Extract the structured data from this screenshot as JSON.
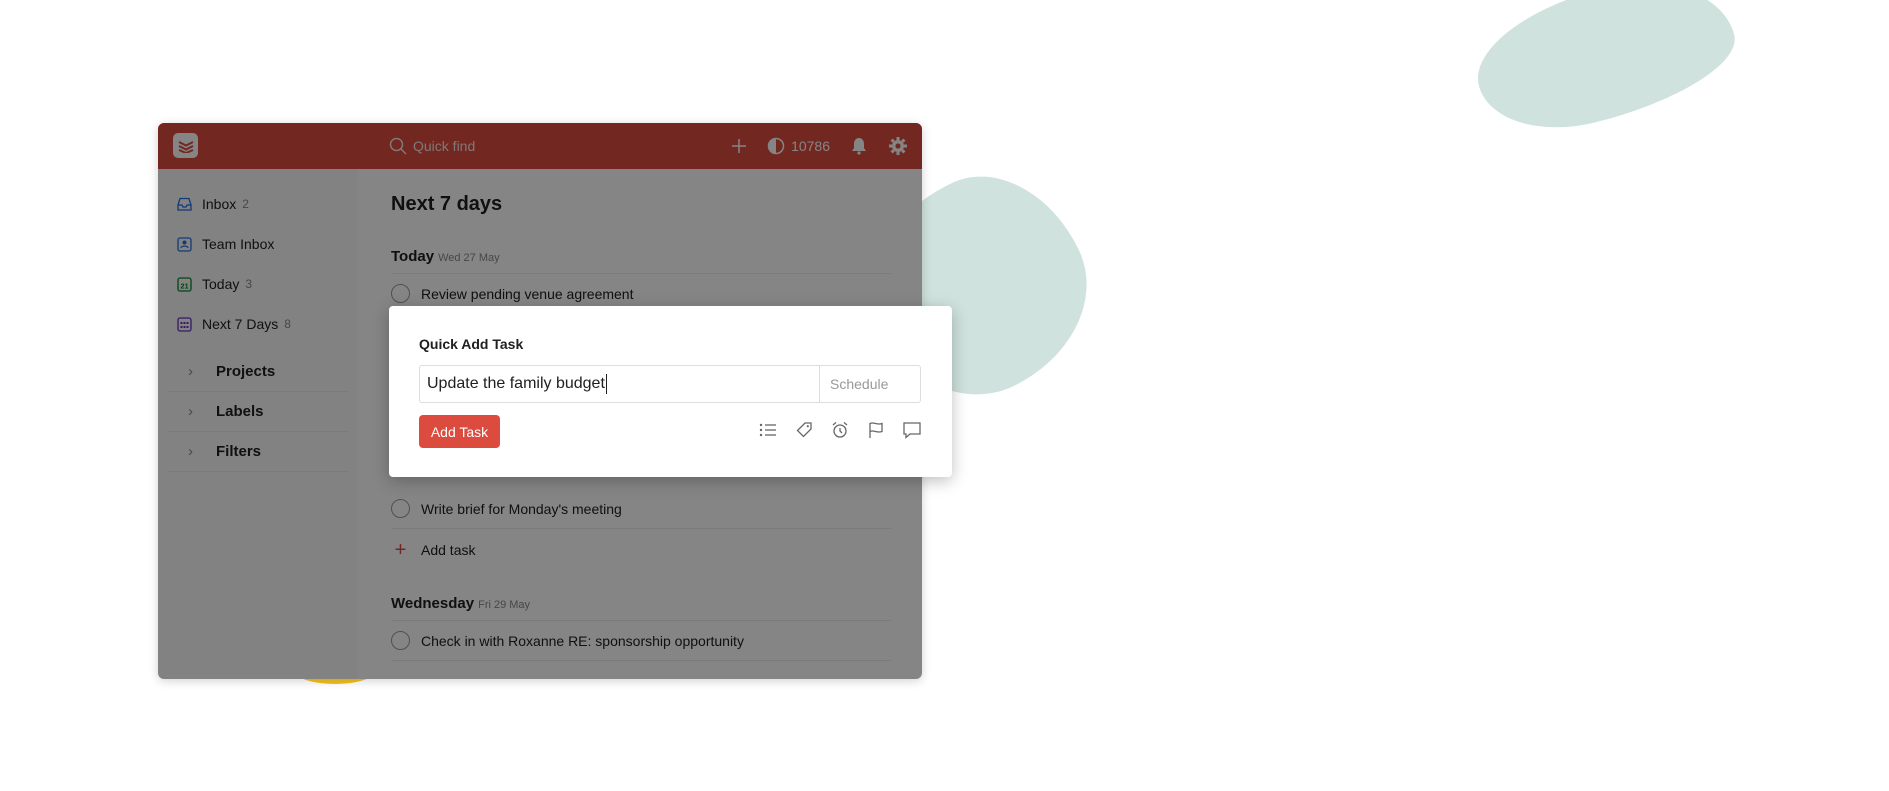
{
  "topbar": {
    "search_placeholder": "Quick find",
    "karma": "10786"
  },
  "sidebar": {
    "items": [
      {
        "label": "Inbox",
        "count": "2",
        "icon": "inbox-icon",
        "color": "#246fe0"
      },
      {
        "label": "Team Inbox",
        "count": "",
        "icon": "team-inbox-icon",
        "color": "#246fe0"
      },
      {
        "label": "Today",
        "count": "3",
        "icon": "calendar-today-icon",
        "color": "#058527"
      },
      {
        "label": "Next 7 Days",
        "count": "8",
        "icon": "calendar-week-icon",
        "color": "#692fc2"
      }
    ],
    "groups": [
      {
        "label": "Projects"
      },
      {
        "label": "Labels"
      },
      {
        "label": "Filters"
      }
    ]
  },
  "main": {
    "title": "Next 7 days",
    "sections": [
      {
        "day": "Today",
        "date": "Wed 27 May"
      },
      {
        "day": "Wednesday",
        "date": "Fri 29 May"
      }
    ],
    "tasks": [
      "Review pending venue agreement",
      "Write brief for Monday's meeting",
      "Check in with Roxanne RE: sponsorship opportunity"
    ],
    "add_task_label": "Add task"
  },
  "modal": {
    "title": "Quick Add Task",
    "input_value": "Update the family budget",
    "schedule_placeholder": "Schedule",
    "add_button": "Add Task",
    "icons": [
      "project-list-icon",
      "label-tag-icon",
      "reminder-alarm-icon",
      "priority-flag-icon",
      "comment-icon"
    ]
  },
  "colors": {
    "brand": "#db4c3f",
    "blob": "#cfe2dd",
    "accent_yellow": "#f6c21a"
  }
}
